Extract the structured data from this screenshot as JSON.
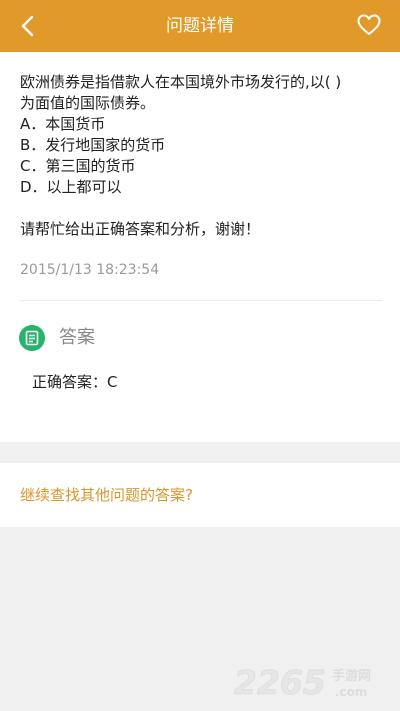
{
  "colors": {
    "header_bg": "#e19a29",
    "link": "#d8962c",
    "answer_icon_bg": "#27b36a",
    "date_gray": "#9a9a9a",
    "page_bg": "#f0f0f0"
  },
  "header": {
    "title": "问题详情",
    "back_icon": "chevron-left-icon",
    "favorite_icon": "heart-outline-icon"
  },
  "question": {
    "lines": [
      "欧洲债券是指借款人在本国境外市场发行的,以( )",
      "为面值的国际债券。",
      "A．本国货币",
      "B．发行地国家的货币",
      "C．第三国的货币",
      "D．以上都可以"
    ],
    "request": "请帮忙给出正确答案和分析，谢谢！",
    "date": "2015/1/13 18:23:54"
  },
  "answer": {
    "heading": "答案",
    "icon": "answer-note-icon",
    "text": "正确答案：C"
  },
  "more": {
    "link_text": "继续查找其他问题的答案?"
  },
  "watermark": {
    "brand": "2265",
    "suffix": "手游网",
    "domain": ".com"
  }
}
